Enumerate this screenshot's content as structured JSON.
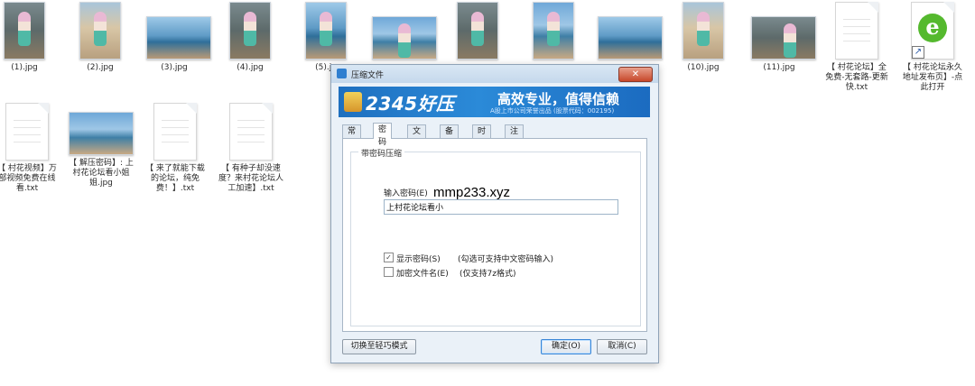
{
  "desktop": {
    "files": [
      {
        "name": "(1).jpg",
        "kind": "photo"
      },
      {
        "name": "(2).jpg",
        "kind": "photo"
      },
      {
        "name": "(3).jpg",
        "kind": "photo"
      },
      {
        "name": "(4).jpg",
        "kind": "photo"
      },
      {
        "name": "(5).jp",
        "kind": "photo"
      },
      {
        "name": "",
        "kind": "photo"
      },
      {
        "name": "",
        "kind": "photo"
      },
      {
        "name": "",
        "kind": "photo"
      },
      {
        "name": "",
        "kind": "photo"
      },
      {
        "name": "(10).jpg",
        "kind": "photo"
      },
      {
        "name": "(11).jpg",
        "kind": "photo"
      },
      {
        "name": "【 村花论坛】全免费-无套路-更新快.txt",
        "kind": "text"
      },
      {
        "name": "【 村花论坛永久地址发布页】-点此打开",
        "kind": "shortcut"
      },
      {
        "name": "【 村花视频】万部视频免费在线看.txt",
        "kind": "text"
      },
      {
        "name": "【 解压密码】: 上村花论坛看小姐姐.jpg",
        "kind": "photo"
      },
      {
        "name": "【 来了就能下载的论坛，纯免费！】.txt",
        "kind": "text"
      },
      {
        "name": "【 有种子却没速度？来村花论坛人工加速】.txt",
        "kind": "text"
      }
    ]
  },
  "dialog": {
    "title": "压缩文件",
    "banner": {
      "brand": "2345好压",
      "slogan": "高效专业，值得信赖",
      "subline": "A股上市公司荣誉出品 (股票代码：002195)"
    },
    "tabs": [
      "常规",
      "密码",
      "文件",
      "备注",
      "时间",
      "注释"
    ],
    "active_tab": "密码",
    "group_title": "带密码压缩",
    "password_label": "输入密码(E)",
    "password_value": "上村花论坛看小",
    "overlay_text": "mmp233.xyz",
    "show_password": {
      "label": "显示密码(S)",
      "hint": "(勾选可支持中文密码输入)",
      "checked": true
    },
    "encrypt_names": {
      "label": "加密文件名(E)",
      "hint": "(仅支持7z格式)",
      "checked": false
    },
    "buttons": {
      "switch_mode": "切换至轻巧模式",
      "ok": "确定(O)",
      "cancel": "取消(C)"
    },
    "close_symbol": "✕"
  }
}
